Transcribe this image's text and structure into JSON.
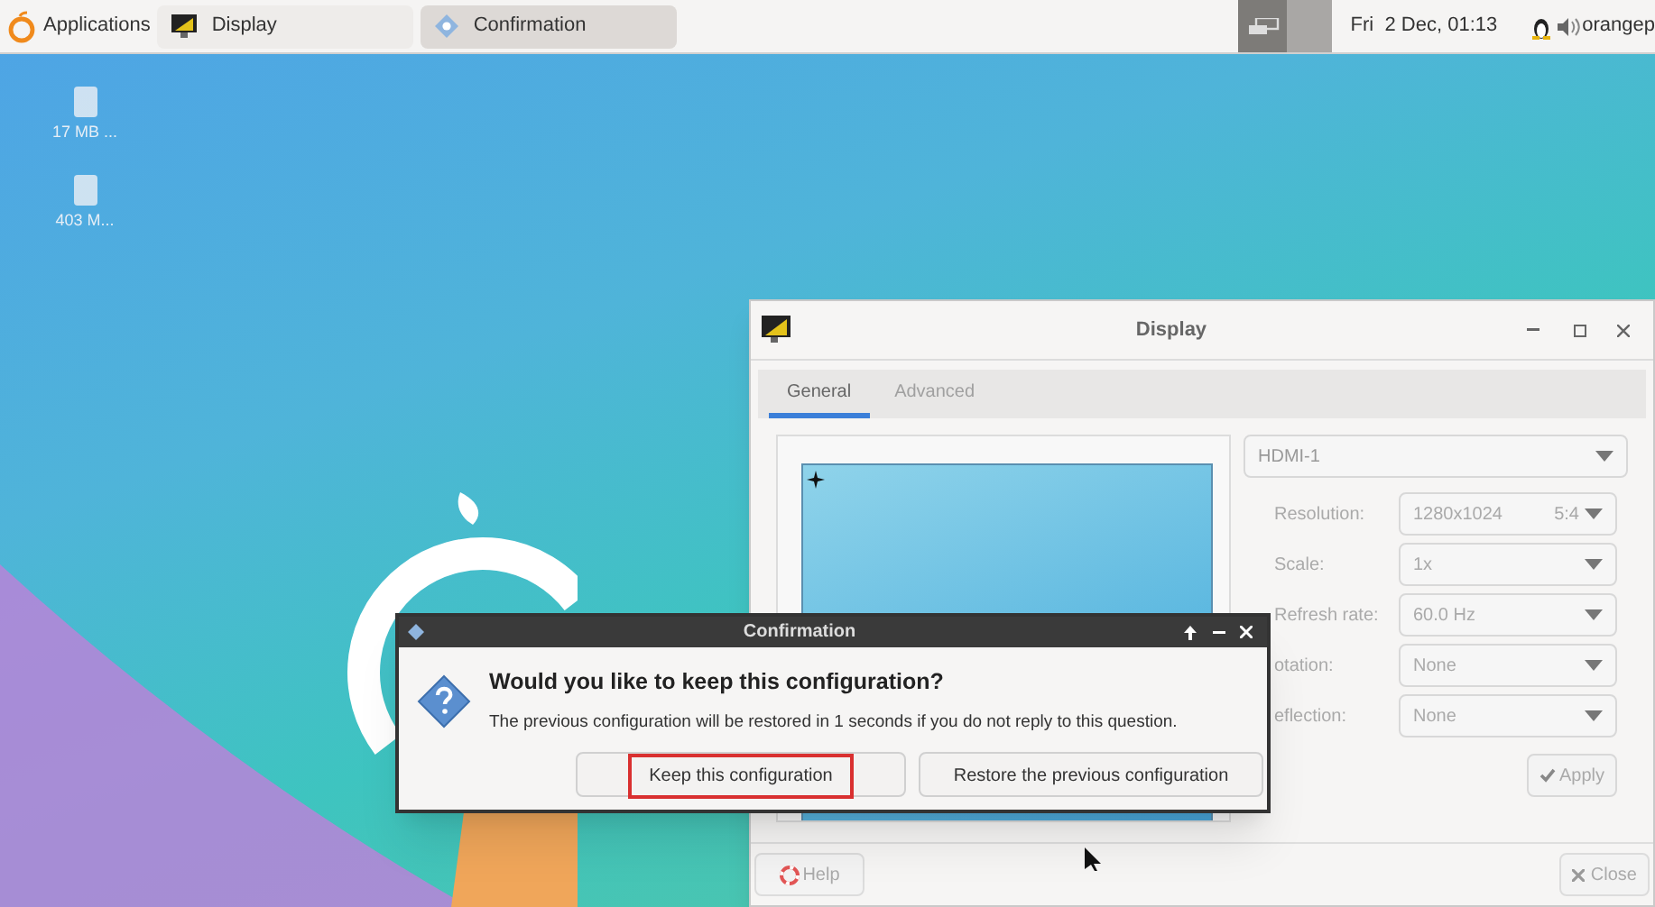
{
  "taskbar": {
    "menu_label": "Applications",
    "tasks": [
      {
        "label": "Display",
        "selected": false
      },
      {
        "label": "Confirmation",
        "selected": true
      }
    ],
    "clock": "Fri  2 Dec, 01:13",
    "user": "orangep"
  },
  "desktop_icons": [
    {
      "label": "17 MB ..."
    },
    {
      "label": "403 M..."
    }
  ],
  "display_window": {
    "title": "Display",
    "tabs": [
      {
        "label": "General",
        "selected": true
      },
      {
        "label": "Advanced",
        "selected": false
      }
    ],
    "output": "HDMI-1",
    "settings": [
      {
        "label": "Resolution:",
        "value": "1280x1024",
        "hint": "5:4"
      },
      {
        "label": "Scale:",
        "value": "1x"
      },
      {
        "label": "Refresh rate:",
        "value": "60.0 Hz"
      },
      {
        "label": "otation:",
        "value": "None"
      },
      {
        "label": "eflection:",
        "value": "None"
      }
    ],
    "apply": "Apply",
    "help": "Help",
    "close": "Close"
  },
  "dialog": {
    "title": "Confirmation",
    "heading": "Would you like to keep this configuration?",
    "message": "The previous configuration will be restored in 1 seconds if you do not reply to this question.",
    "buttons": [
      {
        "label": "Keep this configuration",
        "highlighted": true
      },
      {
        "label": "Restore the previous configuration",
        "highlighted": false
      }
    ]
  }
}
